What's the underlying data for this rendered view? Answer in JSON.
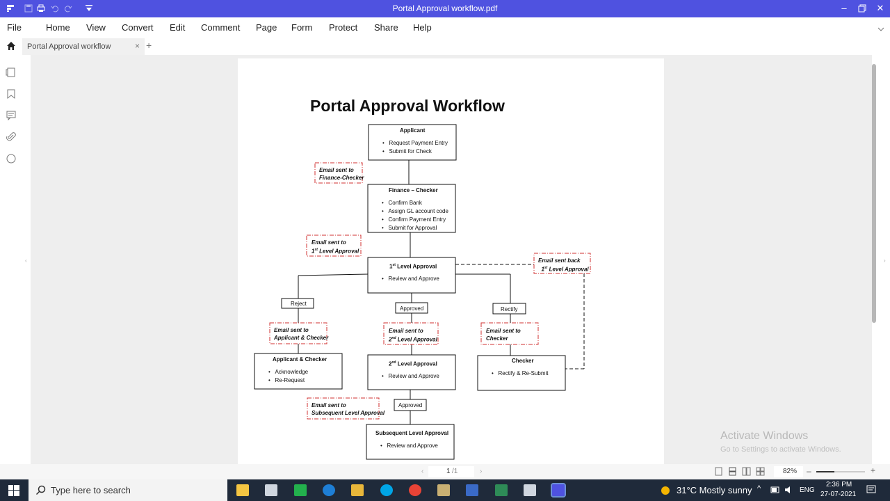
{
  "window": {
    "title": "Portal Approval workflow.pdf"
  },
  "menu": [
    "File",
    "Home",
    "View",
    "Convert",
    "Edit",
    "Comment",
    "Page",
    "Form",
    "Protect",
    "Share",
    "Help"
  ],
  "tab": {
    "label": "Portal Approval workflow",
    "close": "×",
    "new": "+"
  },
  "document": {
    "title": "Portal Approval Workflow",
    "boxes": {
      "applicant": {
        "title": "Applicant",
        "items": [
          "Request Payment Entry",
          "Submit for Check"
        ]
      },
      "finance": {
        "title": "Finance – Checker",
        "items": [
          "Confirm Bank",
          "Assign GL account code",
          "Confirm Payment Entry",
          "Submit for Approval"
        ]
      },
      "level1": {
        "title_pre": "1",
        "title_sup": "st",
        "title_post": " Level Approval",
        "items": [
          "Review and Approve"
        ]
      },
      "level2": {
        "title_pre": "2",
        "title_sup": "nd",
        "title_post": " Level Approval",
        "items": [
          "Review and Approve"
        ]
      },
      "appchecker": {
        "title": "Applicant & Checker",
        "items": [
          "Acknowledge",
          "Re-Request"
        ]
      },
      "checker": {
        "title": "Checker",
        "items": [
          "Rectify & Re-Submit"
        ]
      },
      "subsequent": {
        "title": "Subsequent Level Approval",
        "items": [
          "Review and Approve"
        ]
      }
    },
    "labels": {
      "reject": "Reject",
      "approved1": "Approved",
      "rectify": "Rectify",
      "approved2": "Approved"
    },
    "emails": {
      "finance": [
        "Email sent to",
        "Finance-Checker"
      ],
      "level1": {
        "line1": "Email sent to",
        "pre": "1",
        "sup": "st",
        "post": " Level Approval"
      },
      "back": {
        "line1": "Email sent back",
        "pre": "1",
        "sup": "st",
        "post": " Level Approval"
      },
      "appchecker": [
        "Email sent to",
        "Applicant & Checker"
      ],
      "level2": {
        "line1": "Email sent to",
        "pre": "2",
        "sup": "nd",
        "post": " Level Approval"
      },
      "checker": [
        "Email sent to",
        "Checker"
      ],
      "subsequent": [
        "Email sent to",
        "Subsequent Level Approval"
      ]
    }
  },
  "status": {
    "page": "1",
    "total": "/1",
    "zoom": "82%",
    "minus": "–",
    "plus": "+"
  },
  "watermark": {
    "line1": "Activate Windows",
    "line2": "Go to Settings to activate Windows."
  },
  "taskbar": {
    "search_placeholder": "Type here to search",
    "weather": "31°C  Mostly sunny",
    "lang": "ENG",
    "time": "2:36 PM",
    "date": "27-07-2021"
  },
  "colors": {
    "titlebar": "#4f52e0",
    "taskbar": "#1f2a3a",
    "email_border": "#d03030"
  }
}
